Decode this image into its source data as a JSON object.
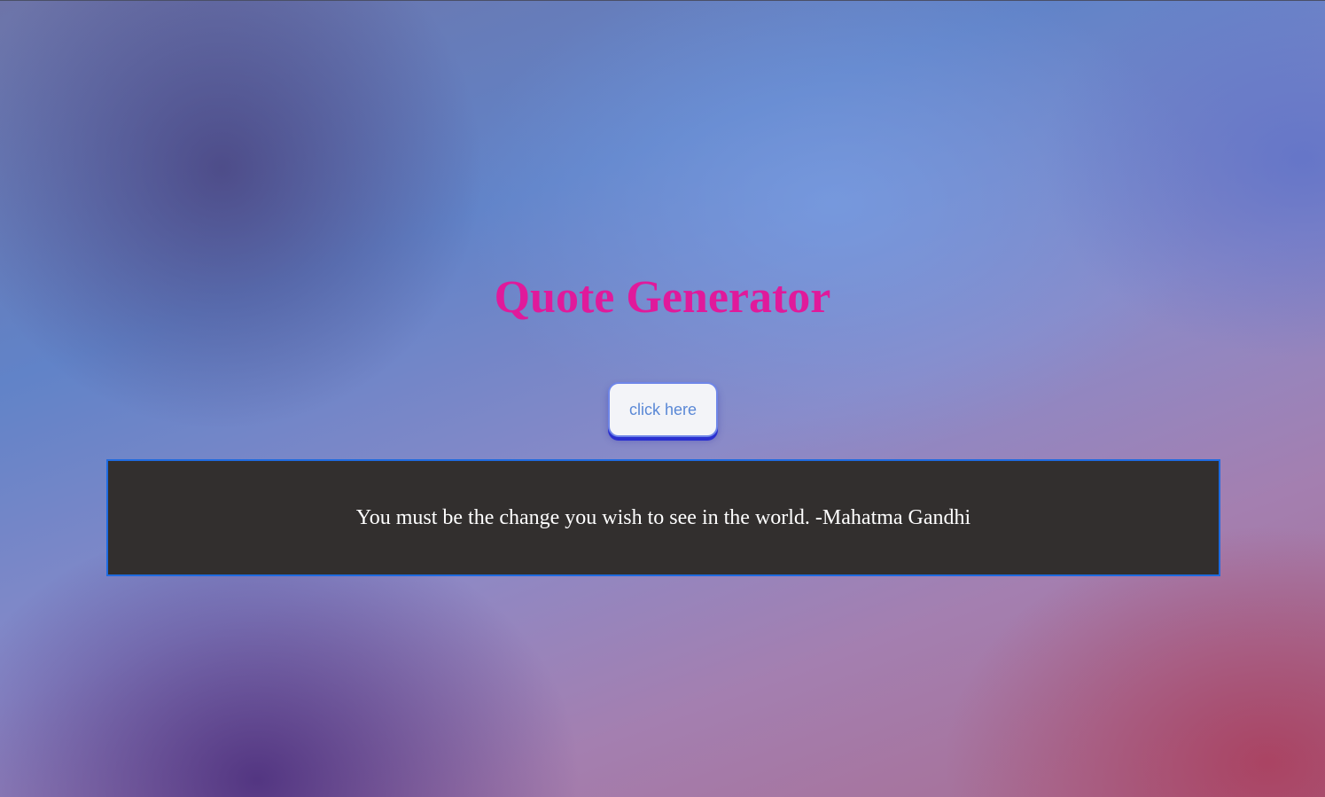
{
  "header": {
    "title": "Quote Generator"
  },
  "actions": {
    "generate_label": "click here"
  },
  "quote": {
    "text": "You must be the change you wish to see in the world. -Mahatma Gandhi"
  },
  "colors": {
    "title": "#e01a9b",
    "button_text": "#5a88d6",
    "button_shadow": "#2a2fd0",
    "quote_background": "#322f2e",
    "quote_border": "#1f6be0",
    "quote_text": "#ffffff"
  }
}
